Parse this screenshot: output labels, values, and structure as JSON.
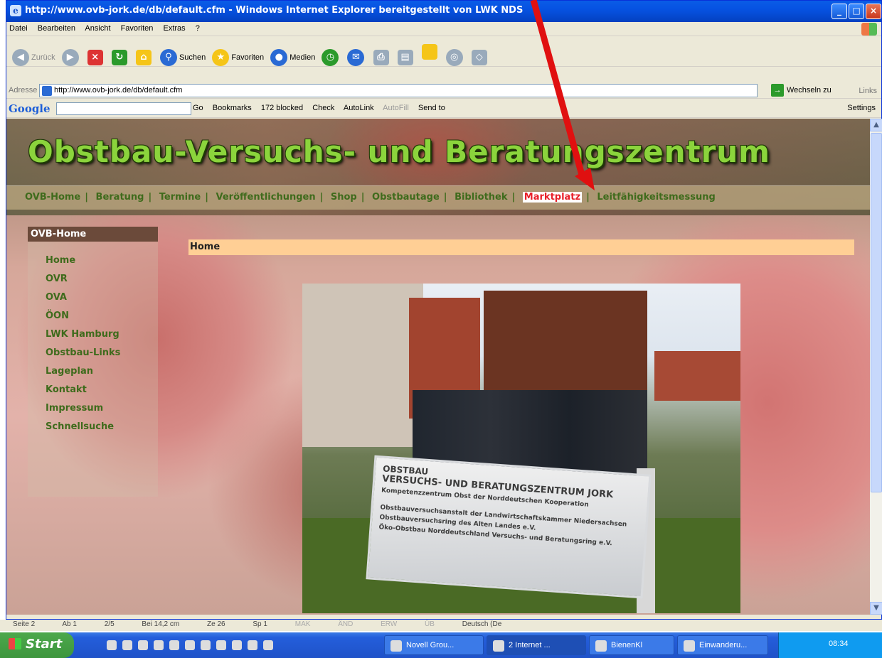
{
  "window": {
    "title": "http://www.ovb-jork.de/db/default.cfm - Windows Internet Explorer bereitgestellt von LWK NDS",
    "controls": [
      "_",
      "□",
      "×"
    ]
  },
  "menubar": [
    "Datei",
    "Bearbeiten",
    "Ansicht",
    "Favoriten",
    "Extras",
    "?"
  ],
  "toolbar": {
    "back": "Zurück",
    "search": "Suchen",
    "favorites": "Favoriten",
    "media": "Medien"
  },
  "addressbar": {
    "label": "Adresse",
    "url": "http://www.ovb-jork.de/db/default.cfm",
    "go": "Wechseln zu",
    "links": "Links"
  },
  "googlebar": {
    "logo": "Google",
    "items": [
      "Go",
      "Bookmarks",
      "172 blocked",
      "Check",
      "AutoLink",
      "AutoFill",
      "Send to"
    ],
    "settings": "Settings"
  },
  "site": {
    "title": "Obstbau-Versuchs- und Beratungszentrum",
    "nav": [
      "OVB-Home",
      "Beratung",
      "Termine",
      "Veröffentlichungen",
      "Shop",
      "Obstbautage",
      "Bibliothek",
      "Marktplatz",
      "Leitfähigkeitsmessung"
    ],
    "nav_active": "Marktplatz",
    "sidebar_title": "OVB-Home",
    "sidebar_items": [
      "Home",
      "OVR",
      "OVA",
      "ÖON",
      "LWK Hamburg",
      "Obstbau-Links",
      "Lageplan",
      "Kontakt",
      "Impressum",
      "Schnellsuche"
    ],
    "breadcrumb": "Home",
    "sign_lines": [
      "OBSTBAU",
      "VERSUCHS- UND BERATUNGSZENTRUM JORK",
      "Kompetenzzentrum Obst der Norddeutschen Kooperation",
      "Obstbauversuchsanstalt der Landwirtschaftskammer Niedersachsen",
      "Obstbauversuchsring des Alten Landes e.V.",
      "Öko-Obstbau Norddeutschland Versuchs- und Beratungsring e.V."
    ]
  },
  "word_status": [
    "Seite 2",
    "Ab 1",
    "2/5",
    "Bei 14,2 cm",
    "Ze 26",
    "Sp 1",
    "MAK",
    "ÄND",
    "ERW",
    "ÜB",
    "Deutsch (De"
  ],
  "taskbar": {
    "start": "Start",
    "tasks": [
      "Novell Grou...",
      "2 Internet ...",
      "BienenKl",
      "Einwanderu..."
    ],
    "clock": "08:34"
  },
  "colors": {
    "nav_text": "#3f6b1c",
    "nav_active": "#e8202a",
    "title_green": "#8bd43c",
    "breadcrumb_bg": "#ffcf95",
    "arrow": "#e01010"
  }
}
